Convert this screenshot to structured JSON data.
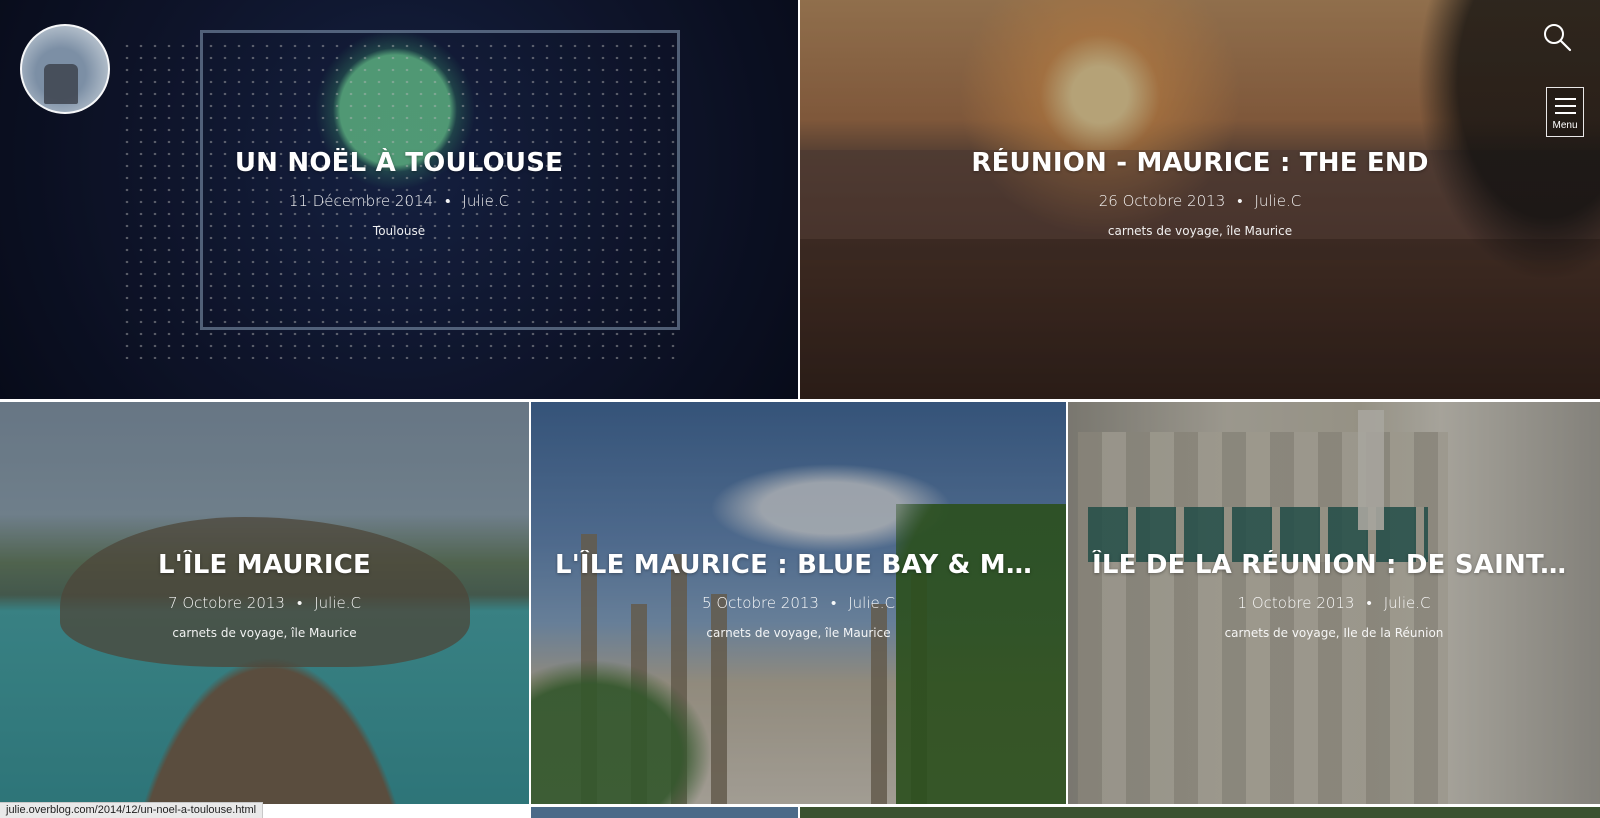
{
  "header": {
    "logo_name": "site-avatar",
    "search_icon": "search-icon",
    "menu_label": "Menu"
  },
  "posts": [
    {
      "title": "UN NOËL À TOULOUSE",
      "date": "11 Décembre 2014",
      "author": "Julie.C",
      "categories": "Toulouse"
    },
    {
      "title": "RÉUNION - MAURICE : THE END",
      "date": "26 Octobre 2013",
      "author": "Julie.C",
      "categories": "carnets de voyage, île Maurice"
    },
    {
      "title": "L'ÎLE MAURICE",
      "date": "7 Octobre 2013",
      "author": "Julie.C",
      "categories": "carnets de voyage, île Maurice"
    },
    {
      "title": "L'ÎLE MAURICE : BLUE BAY & MA...",
      "date": "5 Octobre 2013",
      "author": "Julie.C",
      "categories": "carnets de voyage, île Maurice"
    },
    {
      "title": "ÎLE DE LA RÉUNION : DE SAINT-D...",
      "date": "1 Octobre 2013",
      "author": "Julie.C",
      "categories": "carnets de voyage, Ile de la Réunion"
    }
  ],
  "status_bar": {
    "url": "julie.overblog.com/2014/12/un-noel-a-toulouse.html"
  },
  "colors": {
    "overlay": "#000000",
    "text": "#ffffff"
  }
}
